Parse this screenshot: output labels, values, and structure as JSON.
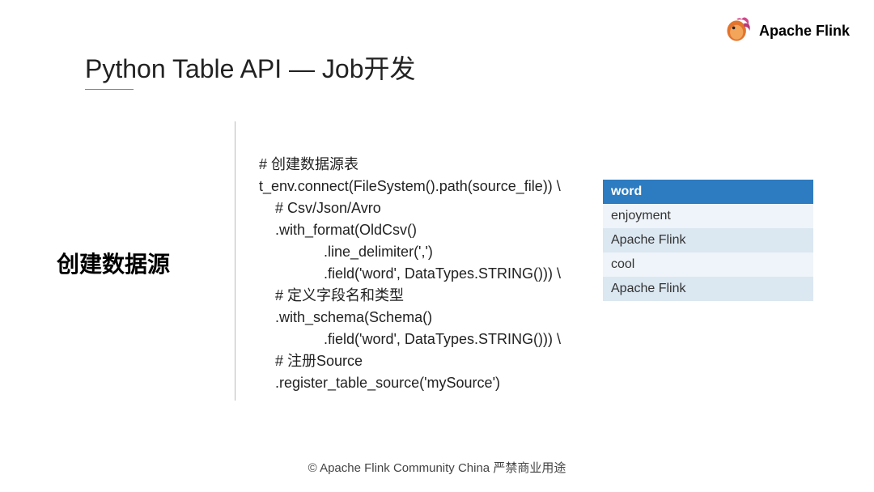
{
  "logo": {
    "text": "Apache Flink"
  },
  "title": "Python Table API — Job开发",
  "section_label": "创建数据源",
  "code": {
    "l1": "# 创建数据源表",
    "l2": "t_env.connect(FileSystem().path(source_file)) \\",
    "l3": "    # Csv/Json/Avro",
    "l4": "    .with_format(OldCsv()",
    "l5": "                .line_delimiter(',')",
    "l6": "                .field('word', DataTypes.STRING())) \\",
    "l7": "    # 定义字段名和类型",
    "l8": "    .with_schema(Schema()",
    "l9": "                .field('word', DataTypes.STRING())) \\",
    "l10": "    # 注册Source",
    "l11": "    .register_table_source('mySource')"
  },
  "table": {
    "header": "word",
    "rows": [
      "enjoyment",
      "Apache Flink",
      "cool",
      "Apache Flink"
    ]
  },
  "footer": "© Apache Flink Community China  严禁商业用途"
}
